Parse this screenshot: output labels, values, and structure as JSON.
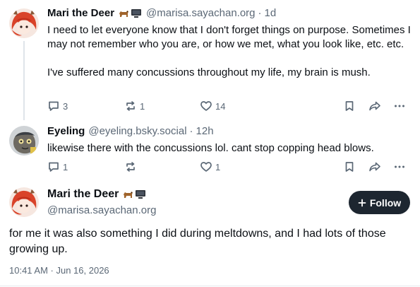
{
  "posts": [
    {
      "author": "Mari the Deer",
      "handle": "@marisa.sayachan.org",
      "separator": "·",
      "time": "1d",
      "text": "I need to let everyone know that I don't forget things on purpose. Sometimes I may not remember who you are, or how we met, what you look like, etc. etc.\n\nI've suffered many concussions throughout my life, my brain is mush.",
      "replies": "3",
      "reposts": "1",
      "likes": "14"
    },
    {
      "author": "Eyeling",
      "handle": "@eyeling.bsky.social",
      "separator": "·",
      "time": "12h",
      "text": "likewise there with the concussions lol. cant stop copping head blows.",
      "replies": "1",
      "reposts": "",
      "likes": "1"
    }
  ],
  "focus_post": {
    "author": "Mari the Deer",
    "handle": "@marisa.sayachan.org",
    "follow_label": "Follow",
    "text": "for me it was also something I did during meltdowns, and I had lots of those growing up.",
    "date": "10:41 AM · Jun 16, 2026"
  },
  "colors": {
    "text": "#0b0f14",
    "muted": "#5b6876",
    "follow_bg": "#1d2630",
    "avatar_red": "#d9432a"
  },
  "icons": [
    "dog-emoji-icon",
    "computer-emoji-icon",
    "reply-icon",
    "repost-icon",
    "like-icon",
    "bookmark-icon",
    "share-icon",
    "more-icon",
    "plus-icon"
  ]
}
